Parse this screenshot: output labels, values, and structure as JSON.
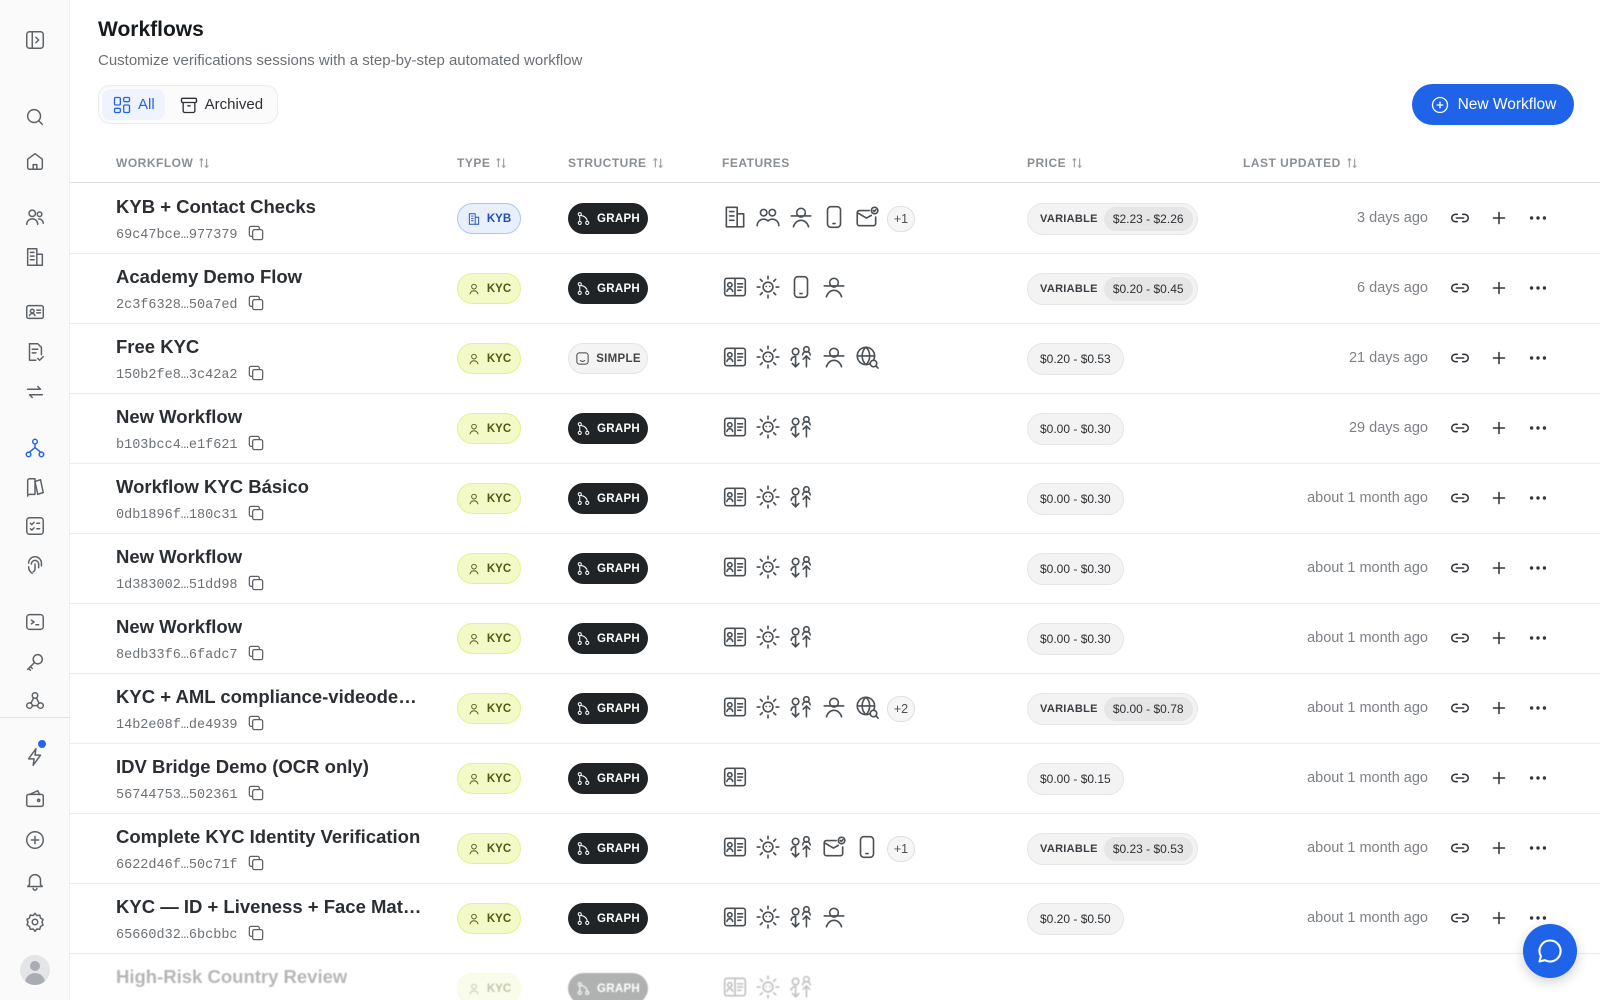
{
  "header": {
    "title": "Workflows",
    "subtitle": "Customize verifications sessions with a step-by-step automated workflow"
  },
  "filters": {
    "all_label": "All",
    "archived_label": "Archived"
  },
  "toolbar": {
    "new_workflow_label": "New Workflow"
  },
  "table": {
    "columns": {
      "workflow": "WORKFLOW",
      "type": "TYPE",
      "structure": "STRUCTURE",
      "features": "FEATURES",
      "price": "PRICE",
      "last_updated": "LAST UPDATED"
    },
    "variable_label": "VARIABLE",
    "rows": [
      {
        "name": "KYB + Contact Checks",
        "id": "69c47bce…977379",
        "type": "KYB",
        "structure": "GRAPH",
        "features": [
          "building-icon",
          "users-icon",
          "liveness-icon",
          "phone-icon",
          "email-check-icon"
        ],
        "more": "+1",
        "price": "$2.23 - $2.26",
        "variable": true,
        "updated": "3 days ago"
      },
      {
        "name": "Academy Demo Flow",
        "id": "2c3f6328…50a7ed",
        "type": "KYC",
        "structure": "GRAPH",
        "features": [
          "id-card-icon",
          "selfie-icon",
          "phone-icon",
          "liveness-icon"
        ],
        "more": "",
        "price": "$0.20 - $0.45",
        "variable": true,
        "updated": "6 days ago"
      },
      {
        "name": "Free KYC",
        "id": "150b2fe8…3c42a2",
        "type": "KYC",
        "structure": "SIMPLE",
        "features": [
          "id-card-icon",
          "selfie-icon",
          "face-match-icon",
          "liveness-icon",
          "globe-search-icon"
        ],
        "more": "",
        "price": "$0.20 - $0.53",
        "variable": false,
        "updated": "21 days ago"
      },
      {
        "name": "New Workflow",
        "id": "b103bcc4…e1f621",
        "type": "KYC",
        "structure": "GRAPH",
        "features": [
          "id-card-icon",
          "selfie-icon",
          "face-match-icon"
        ],
        "more": "",
        "price": "$0.00 - $0.30",
        "variable": false,
        "updated": "29 days ago"
      },
      {
        "name": "Workflow KYC Básico",
        "id": "0db1896f…180c31",
        "type": "KYC",
        "structure": "GRAPH",
        "features": [
          "id-card-icon",
          "selfie-icon",
          "face-match-icon"
        ],
        "more": "",
        "price": "$0.00 - $0.30",
        "variable": false,
        "updated": "about 1 month ago"
      },
      {
        "name": "New Workflow",
        "id": "1d383002…51dd98",
        "type": "KYC",
        "structure": "GRAPH",
        "features": [
          "id-card-icon",
          "selfie-icon",
          "face-match-icon"
        ],
        "more": "",
        "price": "$0.00 - $0.30",
        "variable": false,
        "updated": "about 1 month ago"
      },
      {
        "name": "New Workflow",
        "id": "8edb33f6…6fadc7",
        "type": "KYC",
        "structure": "GRAPH",
        "features": [
          "id-card-icon",
          "selfie-icon",
          "face-match-icon"
        ],
        "more": "",
        "price": "$0.00 - $0.30",
        "variable": false,
        "updated": "about 1 month ago"
      },
      {
        "name": "KYC + AML compliance-videodec…",
        "id": "14b2e08f…de4939",
        "type": "KYC",
        "structure": "GRAPH",
        "features": [
          "id-card-icon",
          "selfie-icon",
          "face-match-icon",
          "liveness-icon",
          "globe-search-icon"
        ],
        "more": "+2",
        "price": "$0.00 - $0.78",
        "variable": true,
        "updated": "about 1 month ago"
      },
      {
        "name": "IDV Bridge Demo (OCR only)",
        "id": "56744753…502361",
        "type": "KYC",
        "structure": "GRAPH",
        "features": [
          "id-card-icon"
        ],
        "more": "",
        "price": "$0.00 - $0.15",
        "variable": false,
        "updated": "about 1 month ago"
      },
      {
        "name": "Complete KYC Identity Verification",
        "id": "6622d46f…50c71f",
        "type": "KYC",
        "structure": "GRAPH",
        "features": [
          "id-card-icon",
          "selfie-icon",
          "face-match-icon",
          "email-check-icon",
          "phone-icon"
        ],
        "more": "+1",
        "price": "$0.23 - $0.53",
        "variable": true,
        "updated": "about 1 month ago"
      },
      {
        "name": "KYC — ID + Liveness + Face Matc…",
        "id": "65660d32…6bcbbc",
        "type": "KYC",
        "structure": "GRAPH",
        "features": [
          "id-card-icon",
          "selfie-icon",
          "face-match-icon",
          "liveness-icon"
        ],
        "more": "",
        "price": "$0.20 - $0.50",
        "variable": false,
        "updated": "about 1 month ago"
      },
      {
        "name": "High-Risk Country Review",
        "id": "",
        "type": "KYC",
        "structure": "GRAPH",
        "features": [
          "id-card-icon",
          "selfie-icon",
          "face-match-icon"
        ],
        "more": "",
        "price": "",
        "variable": false,
        "updated": "",
        "faded": true
      }
    ]
  },
  "sidebar": {
    "items": [
      {
        "icon": "sidebar-toggle-icon"
      },
      {
        "icon": "search-icon"
      },
      {
        "icon": "home-icon"
      },
      {
        "icon": "users-icon"
      },
      {
        "icon": "building-icon"
      },
      {
        "icon": "id-card-icon"
      },
      {
        "icon": "document-check-icon"
      },
      {
        "icon": "transfer-icon"
      },
      {
        "icon": "workflow-icon",
        "active": true
      },
      {
        "icon": "book-icon"
      },
      {
        "icon": "checklist-icon"
      },
      {
        "icon": "fingerprint-icon"
      },
      {
        "icon": "terminal-icon"
      },
      {
        "icon": "key-icon"
      },
      {
        "icon": "webhook-icon"
      },
      {
        "icon": "lightning-icon"
      },
      {
        "icon": "wallet-icon"
      },
      {
        "icon": "plus-circle-icon"
      },
      {
        "icon": "bell-icon"
      },
      {
        "icon": "gear-icon"
      }
    ]
  },
  "colors": {
    "accent": "#1f63e8",
    "kyc_badge": "#f3f9c7",
    "kyb_badge": "#e8f0fd",
    "graph_badge": "#212426"
  }
}
